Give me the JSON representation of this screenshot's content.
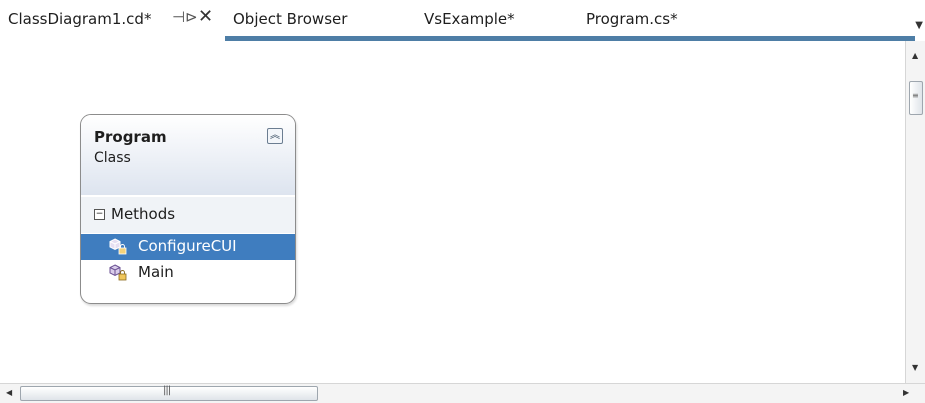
{
  "tabs": [
    {
      "label": "ClassDiagram1.cd*",
      "active": true,
      "pin_icon": "pin-icon",
      "close_icon": "close-icon"
    },
    {
      "label": "Object Browser",
      "active": false
    },
    {
      "label": "VsExample*",
      "active": false
    },
    {
      "label": "Program.cs*",
      "active": false
    }
  ],
  "colors": {
    "accent": "#4e7ea6",
    "selection": "#3f7dbf",
    "header_gradient_end": "#dde4ef"
  },
  "class_shape": {
    "name": "Program",
    "kind": "Class",
    "collapse_icon": "double-chevron-up-icon",
    "section": {
      "label": "Methods",
      "expand_icon": "minus-box-icon",
      "members": [
        {
          "label": "ConfigureCUI",
          "icon": "private-method-icon",
          "selected": true
        },
        {
          "label": "Main",
          "icon": "private-method-icon",
          "selected": false
        }
      ]
    }
  },
  "scrollbars": {
    "vertical": {
      "up_icon": "arrow-up-icon",
      "down_icon": "arrow-down-icon"
    },
    "horizontal": {
      "left_icon": "arrow-left-icon",
      "right_icon": "arrow-right-icon"
    }
  }
}
